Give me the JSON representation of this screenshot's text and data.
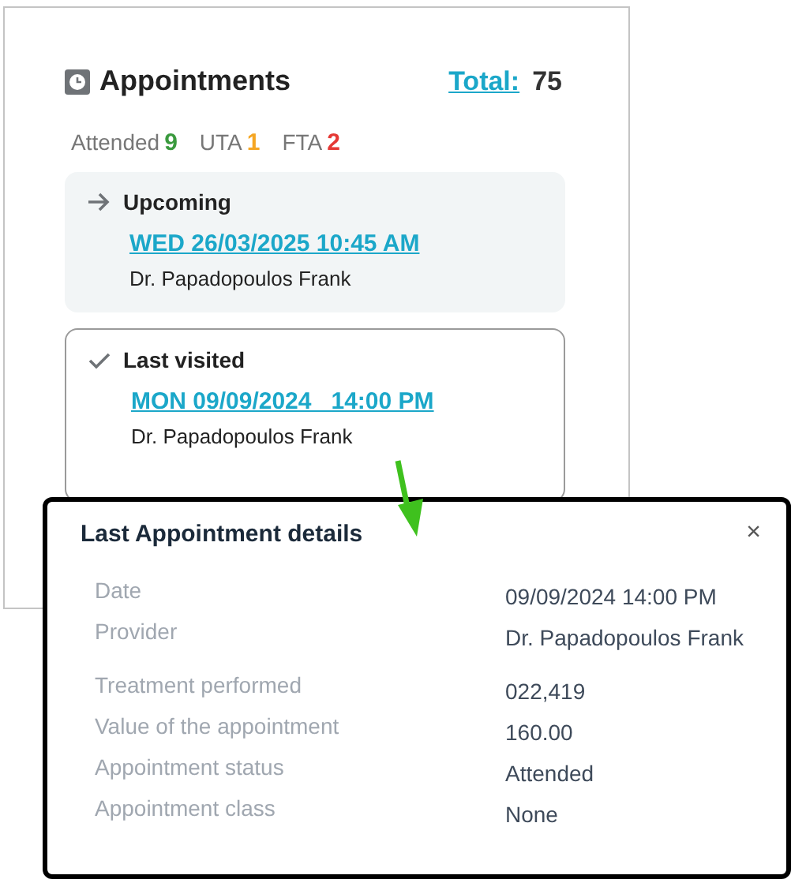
{
  "card": {
    "title": "Appointments",
    "total_label": "Total:",
    "total": "75",
    "stats": [
      {
        "label": "Attended",
        "count": "9",
        "color": "#3a9a3e"
      },
      {
        "label": "UTA",
        "count": "1",
        "color": "#f5a623"
      },
      {
        "label": "FTA",
        "count": "2",
        "color": "#e53935"
      }
    ],
    "entries": [
      {
        "kind": "upcoming",
        "heading": "Upcoming",
        "date": "WED 26/03/2025 10:45 AM",
        "provider": "Dr. Papadopoulos Frank"
      },
      {
        "kind": "last",
        "heading": "Last visited",
        "date": "MON 09/09/2024   14:00 PM",
        "provider": "Dr. Papadopoulos Frank"
      }
    ]
  },
  "popup": {
    "title": "Last Appointment details",
    "close": "×",
    "groups": [
      [
        {
          "label": "Date",
          "value": "09/09/2024 14:00 PM"
        },
        {
          "label": "Provider",
          "value": "Dr. Papadopoulos Frank"
        }
      ],
      [
        {
          "label": "Treatment performed",
          "value": "022,419"
        },
        {
          "label": "Value of the appointment",
          "value": "160.00"
        },
        {
          "label": "Appointment status",
          "value": "Attended"
        },
        {
          "label": "Appointment class",
          "value": "None"
        }
      ]
    ]
  }
}
